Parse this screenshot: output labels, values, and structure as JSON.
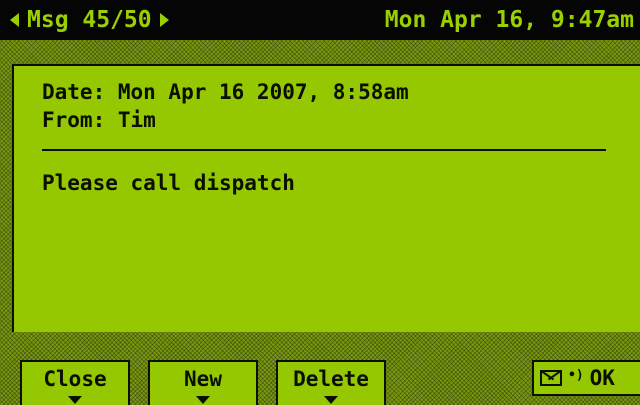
{
  "topbar": {
    "message_counter": "Msg 45/50",
    "clock": "Mon Apr 16, 9:47am"
  },
  "message": {
    "date_line": "Date: Mon Apr 16 2007, 8:58am",
    "from_line": "From: Tim",
    "body": "Please call dispatch"
  },
  "softkeys": {
    "close": "Close",
    "new": "New",
    "delete": "Delete",
    "ok": "OK"
  },
  "icons": {
    "prev": "triangle-left-icon",
    "next": "triangle-right-icon",
    "mail": "envelope-icon",
    "signal": "signal-icon",
    "softkey_arrow": "down-arrow-icon"
  },
  "colors": {
    "screen": "#95c800",
    "topbar_bg": "#050505",
    "topbar_text": "#9bd000"
  }
}
